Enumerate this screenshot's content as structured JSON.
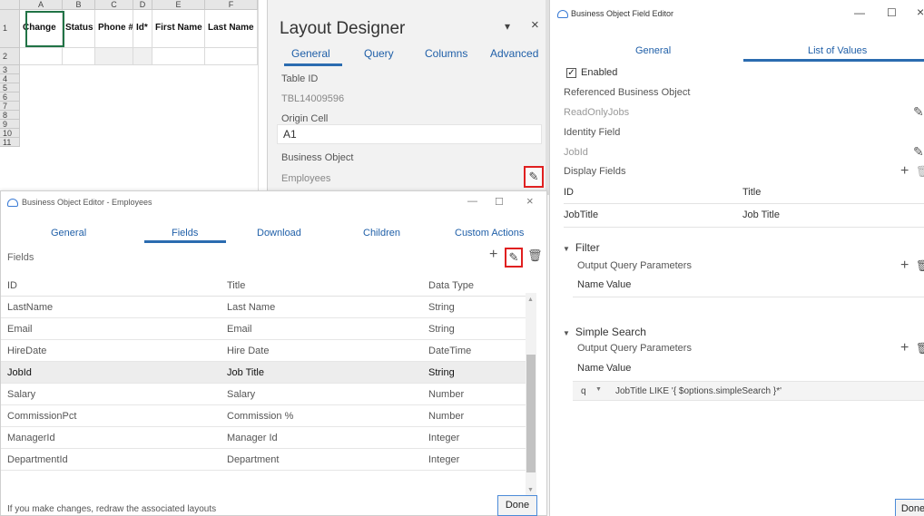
{
  "spreadsheet": {
    "columns": [
      "A",
      "B",
      "C",
      "D",
      "E",
      "F"
    ],
    "rows": [
      "1",
      "2",
      "3",
      "4",
      "5",
      "6",
      "7",
      "8",
      "9",
      "10",
      "11"
    ],
    "header_cells": [
      "Change",
      "Status",
      "Phone #",
      "Id*",
      "First Name",
      "Last Name"
    ]
  },
  "layout_designer": {
    "title": "Layout Designer",
    "dropdown_glyph": "▾",
    "close_glyph": "×",
    "tabs": [
      "General",
      "Query",
      "Columns",
      "Advanced"
    ],
    "table_id_label": "Table ID",
    "table_id_value": "TBL14009596",
    "origin_cell_label": "Origin Cell",
    "origin_cell_value": "A1",
    "business_object_label": "Business Object",
    "business_object_value": "Employees"
  },
  "bo_editor": {
    "window_title": "Business Object Editor - Employees",
    "tabs": [
      "General",
      "Fields",
      "Download",
      "Children",
      "Custom Actions"
    ],
    "fields_label": "Fields",
    "columns": [
      "ID",
      "Title",
      "Data Type"
    ],
    "rows": [
      {
        "id": "LastName",
        "title": "Last Name",
        "type": "String"
      },
      {
        "id": "Email",
        "title": "Email",
        "type": "String"
      },
      {
        "id": "HireDate",
        "title": "Hire Date",
        "type": "DateTime"
      },
      {
        "id": "JobId",
        "title": "Job Title",
        "type": "String"
      },
      {
        "id": "Salary",
        "title": "Salary",
        "type": "Number"
      },
      {
        "id": "CommissionPct",
        "title": "Commission %",
        "type": "Number"
      },
      {
        "id": "ManagerId",
        "title": "Manager Id",
        "type": "Integer"
      },
      {
        "id": "DepartmentId",
        "title": "Department",
        "type": "Integer"
      }
    ],
    "selected_row": "JobId",
    "footer_note": "If you make changes, redraw the associated layouts",
    "done_label": "Done"
  },
  "field_editor": {
    "window_title": "Business Object Field Editor",
    "tabs": [
      "General",
      "List of Values"
    ],
    "enabled_label": "Enabled",
    "enabled": true,
    "referenced_bo_label": "Referenced Business Object",
    "referenced_bo_value": "ReadOnlyJobs",
    "identity_field_label": "Identity Field",
    "identity_field_value": "JobId",
    "display_fields_label": "Display Fields",
    "display_columns": [
      "ID",
      "Title"
    ],
    "display_row": {
      "id": "JobTitle",
      "title": "Job Title"
    },
    "filter_title": "Filter",
    "filter_params_label": "Output Query Parameters",
    "name_label": "Name",
    "value_label": "Value",
    "simple_search_title": "Simple Search",
    "simple_search_params_label": "Output Query Parameters",
    "param_name": "q",
    "param_value": "JobTitle LIKE '{ $options.simpleSearch }*'",
    "done_label": "Done"
  }
}
